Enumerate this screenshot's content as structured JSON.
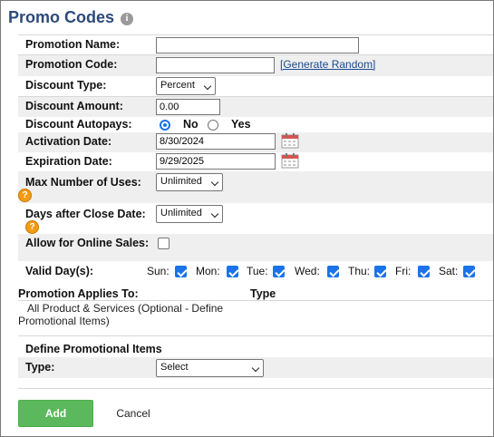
{
  "title": "Promo Codes",
  "info_icon": "i",
  "fields": {
    "promotion_name": {
      "label": "Promotion Name:",
      "value": ""
    },
    "promotion_code": {
      "label": "Promotion Code:",
      "value": "",
      "generate_link": "[Generate Random]"
    },
    "discount_type": {
      "label": "Discount Type:",
      "value": "Percent"
    },
    "discount_amount": {
      "label": "Discount Amount:",
      "value": "0.00"
    },
    "discount_autopays": {
      "label": "Discount Autopays:",
      "options": [
        "No",
        "Yes"
      ],
      "selected": "No"
    },
    "activation_date": {
      "label": "Activation Date:",
      "value": "8/30/2024"
    },
    "expiration_date": {
      "label": "Expiration Date:",
      "value": "9/29/2025"
    },
    "max_uses": {
      "label": "Max Number of Uses:",
      "value": "Unlimited"
    },
    "days_after_close": {
      "label": "Days after Close Date:",
      "value": "Unlimited"
    },
    "allow_online": {
      "label": "Allow for Online Sales:",
      "checked": false
    },
    "valid_days": {
      "label": "Valid Day(s):",
      "days": [
        {
          "name": "Sun:",
          "checked": true
        },
        {
          "name": "Mon:",
          "checked": true
        },
        {
          "name": "Tue:",
          "checked": true
        },
        {
          "name": "Wed:",
          "checked": true
        },
        {
          "name": "Thu:",
          "checked": true
        },
        {
          "name": "Fri:",
          "checked": true
        },
        {
          "name": "Sat:",
          "checked": true
        }
      ]
    }
  },
  "applies_to": {
    "label": "Promotion Applies To:",
    "type_header": "Type",
    "line1": "All Product & Services (Optional - Define",
    "line2": "Promotional Items)"
  },
  "define_items": {
    "heading": "Define Promotional Items",
    "type_label": "Type:",
    "type_value": "Select"
  },
  "buttons": {
    "add": "Add",
    "cancel": "Cancel"
  },
  "help_icon": "?",
  "colors": {
    "title": "#2e4a7a",
    "add_button": "#5cb85c",
    "link": "#1a4a8f",
    "help": "#f39c12",
    "check": "#1a73e8"
  }
}
